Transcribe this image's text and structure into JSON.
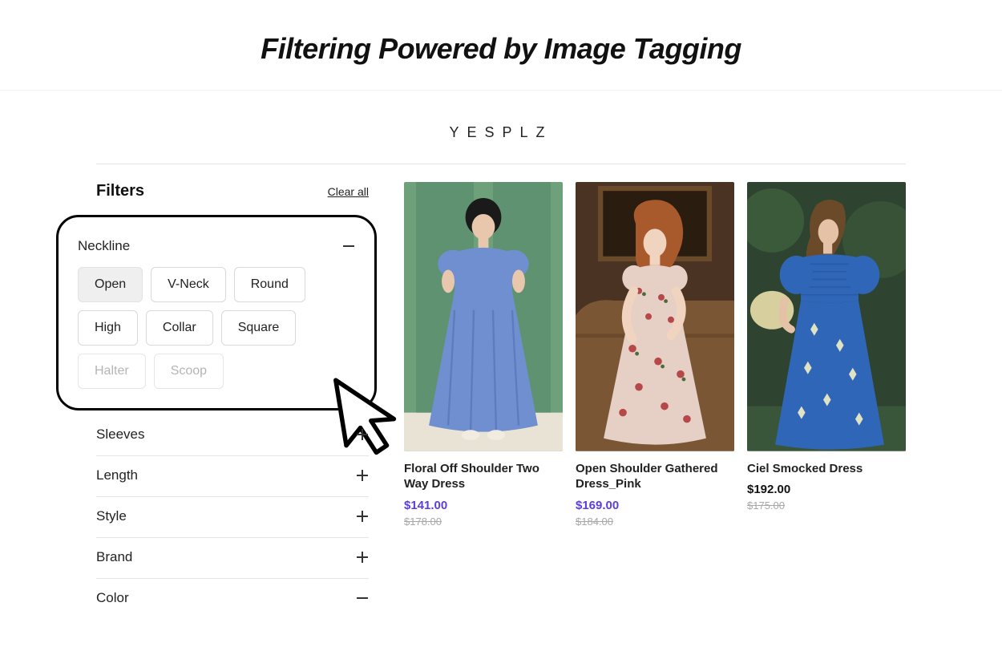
{
  "header": {
    "title": "Filtering Powered by Image Tagging"
  },
  "brand": "YESPLZ",
  "filters": {
    "title": "Filters",
    "clear_all": "Clear all",
    "groups": {
      "neckline": {
        "label": "Neckline",
        "expanded": true,
        "options": [
          {
            "label": "Open",
            "state": "selected"
          },
          {
            "label": "V-Neck",
            "state": "normal"
          },
          {
            "label": "Round",
            "state": "normal"
          },
          {
            "label": "High",
            "state": "normal"
          },
          {
            "label": "Collar",
            "state": "normal"
          },
          {
            "label": "Square",
            "state": "normal"
          },
          {
            "label": "Halter",
            "state": "disabled"
          },
          {
            "label": "Scoop",
            "state": "disabled"
          }
        ]
      },
      "sleeves": {
        "label": "Sleeves",
        "expanded": false
      },
      "length": {
        "label": "Length",
        "expanded": false
      },
      "style": {
        "label": "Style",
        "expanded": false
      },
      "brand": {
        "label": "Brand",
        "expanded": false
      },
      "color": {
        "label": "Color",
        "expanded": true
      }
    }
  },
  "products": [
    {
      "title": "Floral Off Shoulder Two Way Dress",
      "price": "$141.00",
      "price_style": "purple",
      "original_price": "$178.00",
      "palette": {
        "bg": "#6ea07a",
        "dress": "#6f8fd1",
        "skin": "#e8c7ad",
        "hair": "#1a1a1a",
        "floor": "#e9e3d5"
      }
    },
    {
      "title": "Open Shoulder Gathered Dress_Pink",
      "price": "$169.00",
      "price_style": "purple",
      "original_price": "$184.00",
      "palette": {
        "bg": "#5a3b25",
        "dress": "#e6cfc4",
        "flower": "#b6484a",
        "skin": "#f0d4bf",
        "hair": "#a85a2d",
        "sofa": "#7a5634"
      }
    },
    {
      "title": "Ciel Smocked Dress",
      "price": "$192.00",
      "price_style": "black",
      "original_price": "$175.00",
      "palette": {
        "bg": "#2f4430",
        "dress": "#2f66b8",
        "flower": "#dfe3c4",
        "skin": "#e5c2a6",
        "hair": "#6b4a2a"
      }
    }
  ]
}
